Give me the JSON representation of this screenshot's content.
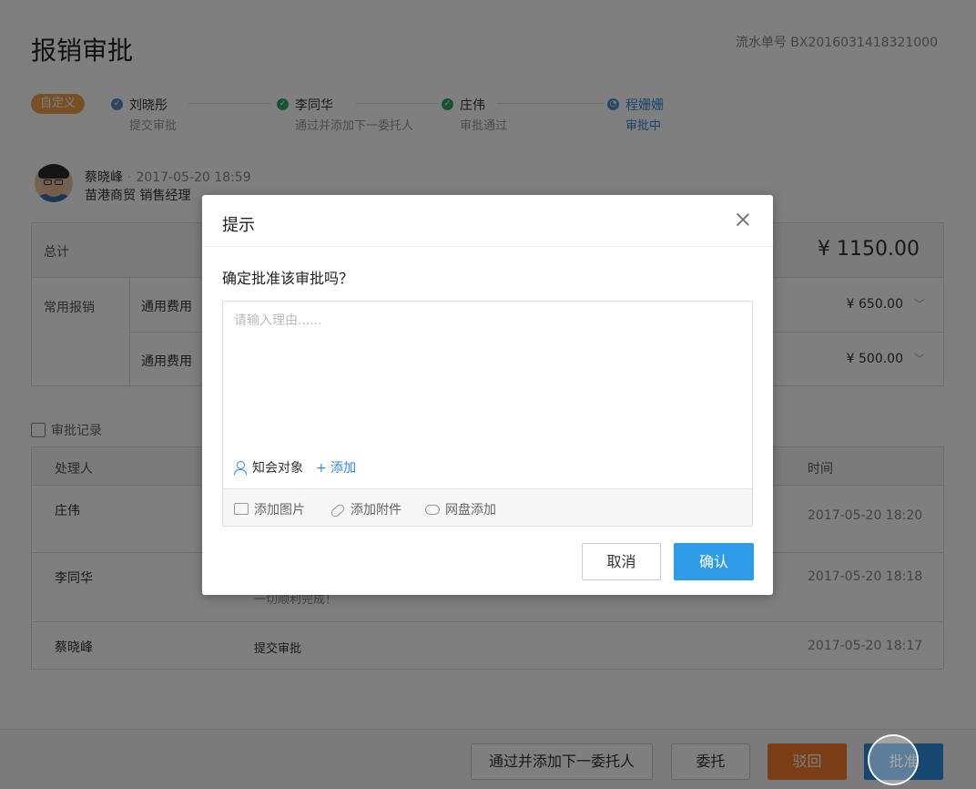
{
  "page": {
    "title": "报销审批",
    "serial": "流水单号 BX2016031418321000"
  },
  "flow": {
    "tag": "自定义",
    "steps": [
      {
        "name": "刘晓彤",
        "desc": "提交审批"
      },
      {
        "name": "李同华",
        "desc": "通过并添加下一委托人"
      },
      {
        "name": "庄伟",
        "desc": "审批通过"
      },
      {
        "name": "程姗姗",
        "desc": "审批中"
      }
    ]
  },
  "submitter": {
    "name": "蔡晓峰",
    "sep": "·",
    "time": "2017-05-20 18:59",
    "org": "苗港商贸 销售经理"
  },
  "expense": {
    "total_label": "总计",
    "total_amount": "¥ 1150.00",
    "category": "常用报销",
    "rows": [
      {
        "label": "通用费用",
        "amount": "¥ 650.00"
      },
      {
        "label": "通用费用",
        "amount": "¥ 500.00"
      }
    ]
  },
  "records": {
    "title": "审批记录",
    "headers": {
      "handler": "处理人",
      "time": "时间"
    },
    "rows": [
      {
        "who": "庄伟",
        "what": "",
        "when": "2017-05-20 18:20"
      },
      {
        "who": "李同华",
        "what": "一切顺利完成！",
        "when": "2017-05-20 18:18"
      },
      {
        "who": "蔡晓峰",
        "what": "提交审批",
        "when": "2017-05-20 18:17"
      }
    ]
  },
  "footer": {
    "pass_add": "通过并添加下一委托人",
    "delegate": "委托",
    "reject": "驳回",
    "approve": "批准"
  },
  "modal": {
    "title": "提示",
    "question": "确定批准该审批吗？",
    "placeholder": "请输入理由......",
    "notify_label": "知会对象",
    "notify_add": "+ 添加",
    "add_image": "添加图片",
    "add_attachment": "添加附件",
    "add_cloud": "网盘添加",
    "cancel": "取消",
    "confirm": "确认"
  },
  "colors": {
    "accent": "#2e8fe0",
    "tag": "#f0a04b",
    "reject": "#f47b2c",
    "done": "#2eaa5c"
  }
}
